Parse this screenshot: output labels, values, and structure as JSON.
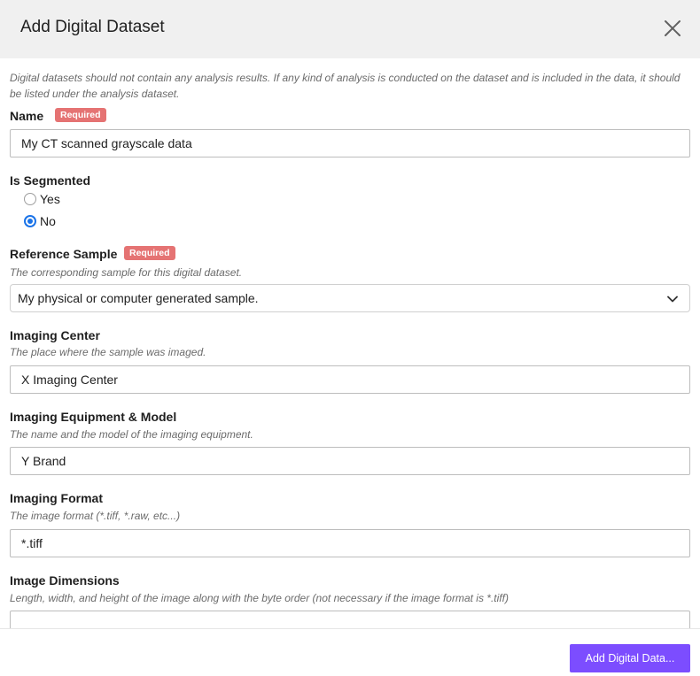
{
  "dialog": {
    "title": "Add Digital Dataset",
    "intro": "Digital datasets should not contain any analysis results. If any kind of analysis is conducted on the dataset and is included in the data, it should be listed under the analysis dataset.",
    "required_badge": "Required"
  },
  "fields": {
    "name": {
      "label": "Name",
      "value": "My CT scanned grayscale data"
    },
    "is_segmented": {
      "label": "Is Segmented",
      "options": [
        "Yes",
        "No"
      ],
      "selected": "No"
    },
    "reference_sample": {
      "label": "Reference Sample",
      "helper": "The corresponding sample for this digital dataset.",
      "value": "My physical or computer generated sample."
    },
    "imaging_center": {
      "label": "Imaging Center",
      "helper": "The place where the sample was imaged.",
      "value": "X Imaging Center"
    },
    "imaging_equipment": {
      "label": "Imaging Equipment & Model",
      "helper": "The name and the model of the imaging equipment.",
      "value": "Y Brand"
    },
    "imaging_format": {
      "label": "Imaging Format",
      "helper": "The image format (*.tiff, *.raw, etc...)",
      "value": "*.tiff"
    },
    "image_dimensions": {
      "label": "Image Dimensions",
      "helper": "Length, width, and height of the image along with the byte order (not necessary if the image format is *.tiff)",
      "value": ""
    }
  },
  "footer": {
    "submit_label": "Add Digital Data..."
  },
  "colors": {
    "accent": "#7c4dff",
    "radio_selected": "#1a73e8",
    "required_badge": "#e57373",
    "header_bg": "#f0f0f0"
  },
  "icons": {
    "close": "close-icon",
    "select_chevron": "chevron-down-icon"
  }
}
